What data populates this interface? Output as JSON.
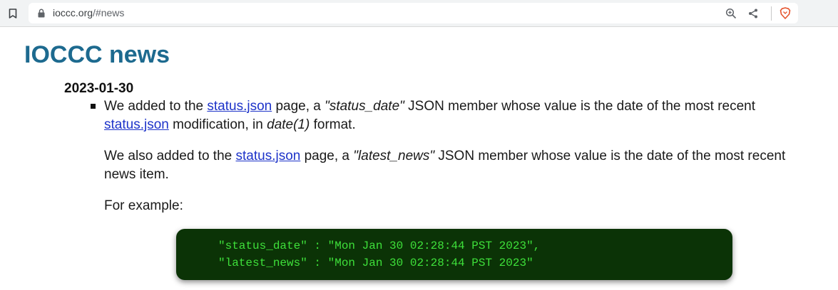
{
  "browser": {
    "url_host": "ioccc.org",
    "url_path": "/#news",
    "icons": [
      "bookmark-icon",
      "lock-icon",
      "zoom-icon",
      "share-icon",
      "brave-shield-icon"
    ]
  },
  "page": {
    "title": "IOCCC news",
    "news": [
      {
        "date": "2023-01-30",
        "p1": {
          "t1": "We added to the ",
          "link1": "status.json",
          "t2": " page, a ",
          "em1": "\"status_date\"",
          "t3": " JSON member whose value is the date of the most recent ",
          "link2": "status.json",
          "t4": " modification, in ",
          "em2": "date(1)",
          "t5": " format."
        },
        "p2": {
          "t1": "We also added to the ",
          "link1": "status.json",
          "t2": " page, a ",
          "em1": "\"latest_news\"",
          "t3": " JSON member whose value is the date of the most recent news item."
        },
        "p3": "For example:",
        "code": [
          "\"status_date\" : \"Mon Jan 30 02:28:44 PST 2023\",",
          "\"latest_news\" : \"Mon Jan 30 02:28:44 PST 2023\""
        ]
      }
    ]
  },
  "colors": {
    "title": "#1d6a8f",
    "link": "#1d33c9",
    "code_bg": "#0b3306",
    "code_text": "#3ee03a"
  }
}
